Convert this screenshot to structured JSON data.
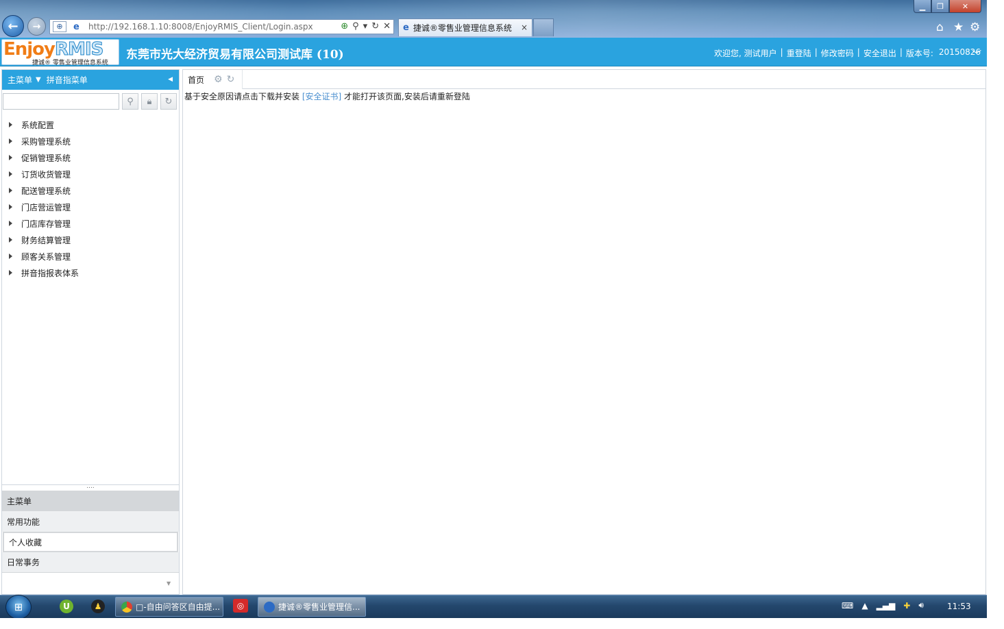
{
  "browser": {
    "url": "http://192.168.1.10:8008/EnjoyRMIS_Client/Login.aspx",
    "tab_title": "捷诚®零售业管理信息系统",
    "tab_close": "×"
  },
  "app": {
    "logo_main": "Enjoy",
    "logo_accent": "RMIS",
    "logo_sub": "捷诚® 零售业管理信息系统",
    "company": "东莞市光大经济贸易有限公司测试库 (10)",
    "user_links": [
      "欢迎您, 测试用户",
      "重登陆",
      "修改密码",
      "安全退出"
    ],
    "version_label": "版本号:",
    "version": "20150826"
  },
  "sidebar": {
    "main_menu_label": "主菜单",
    "pinyin_menu_label": "拼音指菜单",
    "tree_items": [
      {
        "label": "系统配置"
      },
      {
        "label": "采购管理系统"
      },
      {
        "label": "促销管理系统"
      },
      {
        "label": "订货收货管理"
      },
      {
        "label": "配送管理系统"
      },
      {
        "label": "门店营运管理"
      },
      {
        "label": "门店库存管理"
      },
      {
        "label": "财务结算管理"
      },
      {
        "label": "顾客关系管理"
      },
      {
        "label": "拼音指报表体系"
      }
    ],
    "splitter": "....",
    "accordion": [
      "主菜单",
      "常用功能",
      "个人收藏",
      "日常事务"
    ]
  },
  "main": {
    "home_tab": "首页",
    "notice_prefix": "基于安全原因请点击下载并安装",
    "notice_link": "[安全证书]",
    "notice_suffix": "才能打开该页面,安装后请重新登陆"
  },
  "taskbar": {
    "tasks": [
      {
        "label": "□-自由问答区自由提..."
      },
      {
        "label": "捷诚®零售业管理信..."
      }
    ],
    "clock": "11:53"
  },
  "colors": {
    "header_blue": "#2aa3df",
    "logo_orange": "#f07d17",
    "link_blue": "#4a8fd0"
  }
}
